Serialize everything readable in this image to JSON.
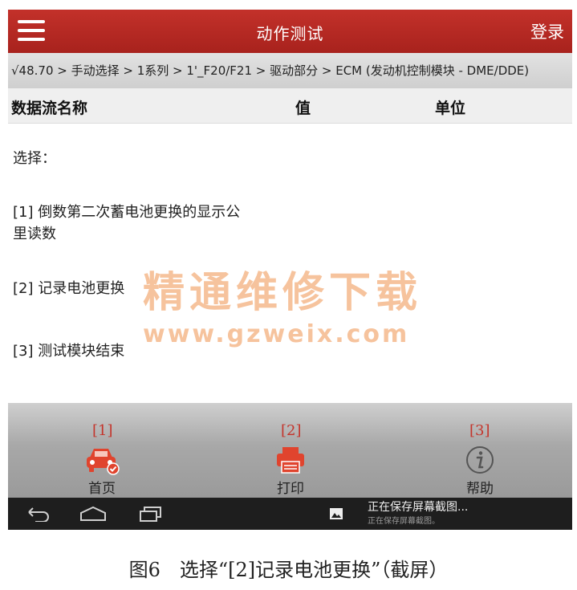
{
  "topbar": {
    "title": "动作测试",
    "login_label": "登录"
  },
  "breadcrumb": "√48.70 > 手动选择 > 1系列 > 1'_F20/F21 > 驱动部分 > ECM (发动机控制模块 - DME/DDE)",
  "columns": {
    "name": "数据流名称",
    "value": "值",
    "unit": "单位"
  },
  "content": {
    "prompt": "选择：",
    "options": [
      {
        "line1": "[1] 倒数第二次蓄电池更换的显示公",
        "line2": "里读数"
      },
      {
        "line1": "[2] 记录电池更换"
      },
      {
        "line1": "[3] 测试模块结束"
      }
    ]
  },
  "watermark": {
    "title": "精通维修下载",
    "url": "www.gzweix.com"
  },
  "bottom_nav": {
    "markers": [
      "[1]",
      "[2]",
      "[3]"
    ],
    "items": [
      {
        "label": "首页",
        "icon": "car-check-icon"
      },
      {
        "label": "打印",
        "icon": "printer-icon"
      },
      {
        "label": "帮助",
        "icon": "info-icon"
      }
    ]
  },
  "system_bar": {
    "toast_title": "正在保存屏幕截图...",
    "toast_sub": "正在保存屏幕截图。"
  },
  "caption": "图6　选择“[2]记录电池更换”（截屏）",
  "colors": {
    "header_red": "#b5271f",
    "marker_red": "#c4352c",
    "icon_red": "#e0442e",
    "watermark": "#f5b98c"
  }
}
